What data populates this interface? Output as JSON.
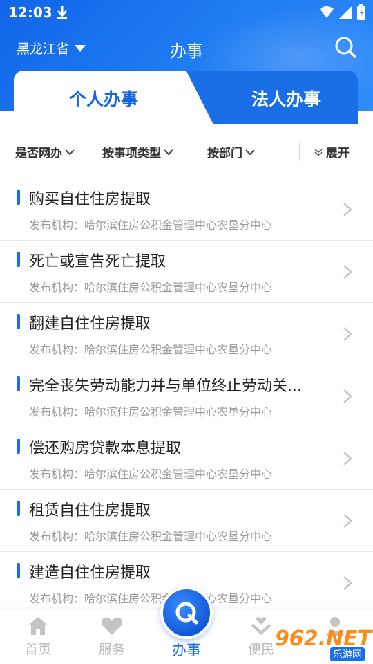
{
  "status_bar": {
    "time": "12:03"
  },
  "header": {
    "province": "黑龙江省",
    "title": "办事"
  },
  "tabs": {
    "active": "个人办事",
    "inactive": "法人办事"
  },
  "filters": {
    "online": "是否网办",
    "type": "按事项类型",
    "dept": "按部门",
    "expand": "展开"
  },
  "items": [
    {
      "title": "购买自住住房提取",
      "sub": "发布机构：哈尔滨住房公积金管理中心农垦分中心"
    },
    {
      "title": "死亡或宣告死亡提取",
      "sub": "发布机构：哈尔滨住房公积金管理中心农垦分中心"
    },
    {
      "title": "翻建自住住房提取",
      "sub": "发布机构：哈尔滨住房公积金管理中心农垦分中心"
    },
    {
      "title": "完全丧失劳动能力并与单位终止劳动关...",
      "sub": "发布机构：哈尔滨住房公积金管理中心农垦分中心"
    },
    {
      "title": "偿还购房贷款本息提取",
      "sub": "发布机构：哈尔滨住房公积金管理中心农垦分中心"
    },
    {
      "title": "租赁自住住房提取",
      "sub": "发布机构：哈尔滨住房公积金管理中心农垦分中心"
    },
    {
      "title": "建造自住住房提取",
      "sub": "发布机构：哈尔滨住房公积金管理中心农垦分中心"
    }
  ],
  "bottom_nav": {
    "home": "首页",
    "service": "服务",
    "affairs": "办事",
    "convenience": "便民"
  },
  "watermark": {
    "brand": "962.NET",
    "sub": "乐游网"
  },
  "colors": {
    "primary": "#1a6fe6",
    "inactive": "#b9b9b9",
    "subtext": "#9a9a9a"
  }
}
